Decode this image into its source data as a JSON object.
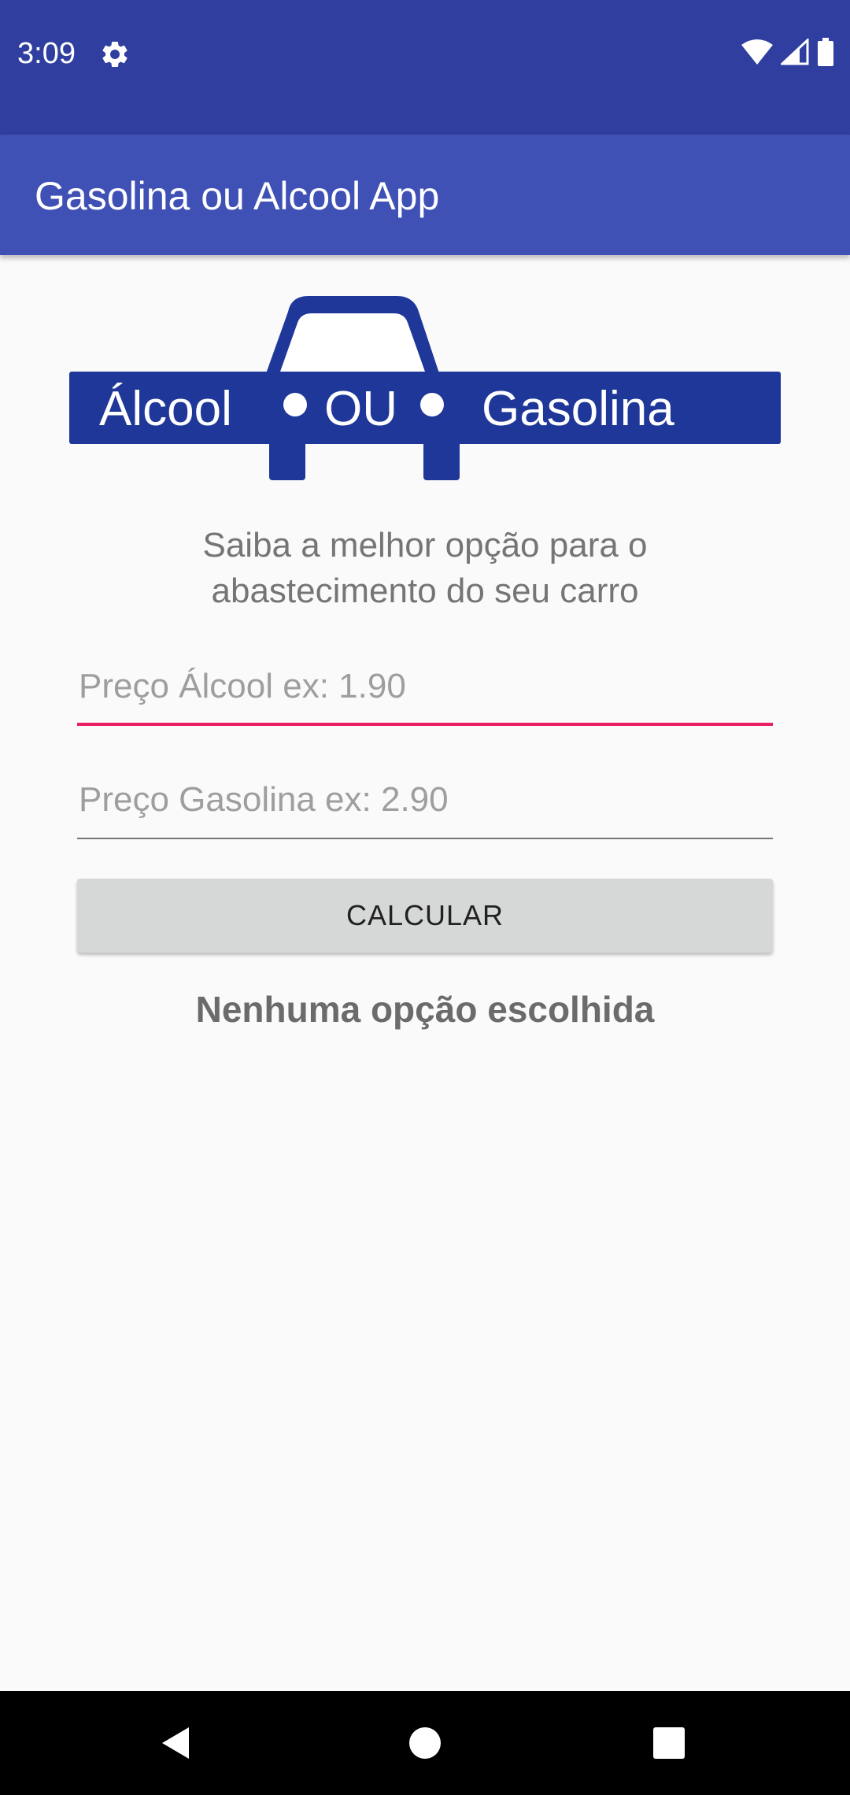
{
  "status_bar": {
    "time": "3:09",
    "icons": [
      "settings-icon",
      "wifi-icon",
      "signal-icon",
      "battery-icon"
    ]
  },
  "app_bar": {
    "title": "Gasolina ou Alcool App"
  },
  "logo": {
    "word_left": "Álcool",
    "word_middle": "OU",
    "word_right": "Gasolina",
    "color": "#1e3799"
  },
  "content": {
    "subtitle_line1": "Saiba a melhor opção para o",
    "subtitle_line2": "abastecimento do seu carro",
    "alcohol_field": {
      "value": "",
      "placeholder": "Preço Álcool ex: 1.90"
    },
    "gasoline_field": {
      "value": "",
      "placeholder": "Preço Gasolina ex: 2.90"
    },
    "calculate_button": "CALCULAR",
    "result_text": "Nenhuma opção escolhida"
  },
  "navigation_bar": {
    "icons": [
      "back-icon",
      "home-icon",
      "recents-icon"
    ]
  },
  "colors": {
    "status_bar": "#303f9f",
    "app_bar": "#3f51b5",
    "accent": "#e91e63",
    "background": "#fafafa"
  }
}
